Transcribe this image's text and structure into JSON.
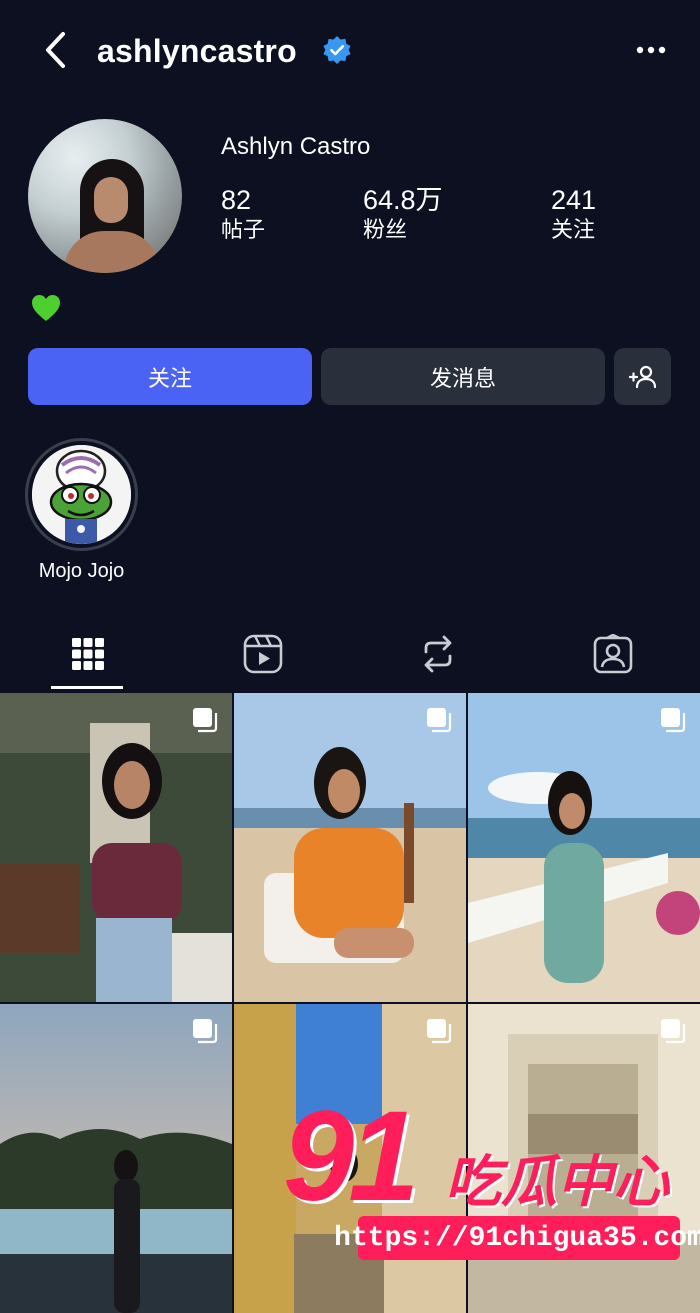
{
  "header": {
    "username": "ashlyncastro",
    "back_icon": "chevron-left-icon",
    "verified_icon": "verified-badge-icon",
    "more_icon": "more-horizontal-icon"
  },
  "profile": {
    "full_name": "Ashlyn Castro",
    "bio_emoji": "💚",
    "stats": [
      {
        "value": "82",
        "label": "帖子"
      },
      {
        "value": "64.8万",
        "label": "粉丝"
      },
      {
        "value": "241",
        "label": "关注"
      }
    ]
  },
  "actions": {
    "follow_label": "关注",
    "message_label": "发消息",
    "add_user_icon": "add-person-icon"
  },
  "highlights": [
    {
      "label": "Mojo Jojo"
    }
  ],
  "tabs": [
    {
      "icon": "grid-icon",
      "selected": true
    },
    {
      "icon": "reels-icon",
      "selected": false
    },
    {
      "icon": "repost-icon",
      "selected": false
    },
    {
      "icon": "tagged-icon",
      "selected": false
    }
  ],
  "posts": [
    {
      "type": "carousel"
    },
    {
      "type": "carousel"
    },
    {
      "type": "carousel"
    },
    {
      "type": "carousel"
    },
    {
      "type": "carousel"
    },
    {
      "type": "carousel"
    }
  ],
  "watermark": {
    "big": "91",
    "text": "吃瓜中心",
    "url": "https://91chigua35.com"
  },
  "colors": {
    "background": "#0c1020",
    "follow_button": "#4a63f5",
    "secondary_button": "#2a2f3c",
    "verified": "#3897f0",
    "watermark": "#ff1e5a"
  }
}
